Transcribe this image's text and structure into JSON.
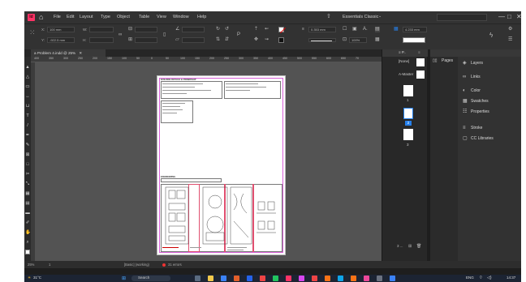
{
  "app": {
    "logo": "Id",
    "menus": [
      "File",
      "Edit",
      "Layout",
      "Type",
      "Object",
      "Table",
      "View",
      "Window",
      "Help"
    ],
    "workspace": "Essentials Classic",
    "window_controls": [
      "—",
      "□",
      "✕"
    ]
  },
  "control_bar": {
    "x_label": "X:",
    "x_value": "100 mm",
    "y_label": "Y:",
    "y_value": "-922.5 mm",
    "w_label": "W:",
    "h_label": "H:",
    "stroke_weight": "0.353 mm",
    "zoom_percent": "100%",
    "ref_value": "4.233 mm"
  },
  "document": {
    "tab_title": "a Problem 4.indd @ 25%",
    "ruler_ticks": [
      "400",
      "350",
      "300",
      "250",
      "200",
      "150",
      "100",
      "50",
      "0",
      "50",
      "100",
      "150",
      "200",
      "250",
      "300",
      "350",
      "400",
      "450",
      "500",
      "550",
      "600",
      "650",
      "70"
    ],
    "page_header": "BUILDING DETAILS & OWNERSHIP",
    "page_footer_label": "ENGINEERING"
  },
  "pages_panel": {
    "title": "Pages",
    "none_label": "[None]",
    "master_label": "A-Master",
    "page_numbers": [
      "1",
      "2",
      "3"
    ],
    "footer_text": "3 ..."
  },
  "side_panels": [
    {
      "name": "Layers",
      "icon": "layers-icon"
    },
    {
      "name": "Links",
      "icon": "links-icon"
    },
    {
      "name": "Color",
      "icon": "color-icon"
    },
    {
      "name": "Swatches",
      "icon": "swatches-icon"
    },
    {
      "name": "Properties",
      "icon": "properties-icon"
    },
    {
      "name": "Stroke",
      "icon": "stroke-icon"
    },
    {
      "name": "CC Libraries",
      "icon": "cc-libraries-icon"
    }
  ],
  "status_bar": {
    "zoom": "25%",
    "page": "1",
    "style": "[Basic] (working)",
    "errors": "31 errors"
  },
  "taskbar": {
    "search": "Search",
    "weather": "31°C",
    "lang": "ENG",
    "time": "14:37"
  },
  "colors": {
    "app_bg": "#1e1e1e",
    "bar_bg": "#323232",
    "pasteboard": "#535353",
    "accent": "#ff3366",
    "selection_blue": "#2680eb"
  }
}
